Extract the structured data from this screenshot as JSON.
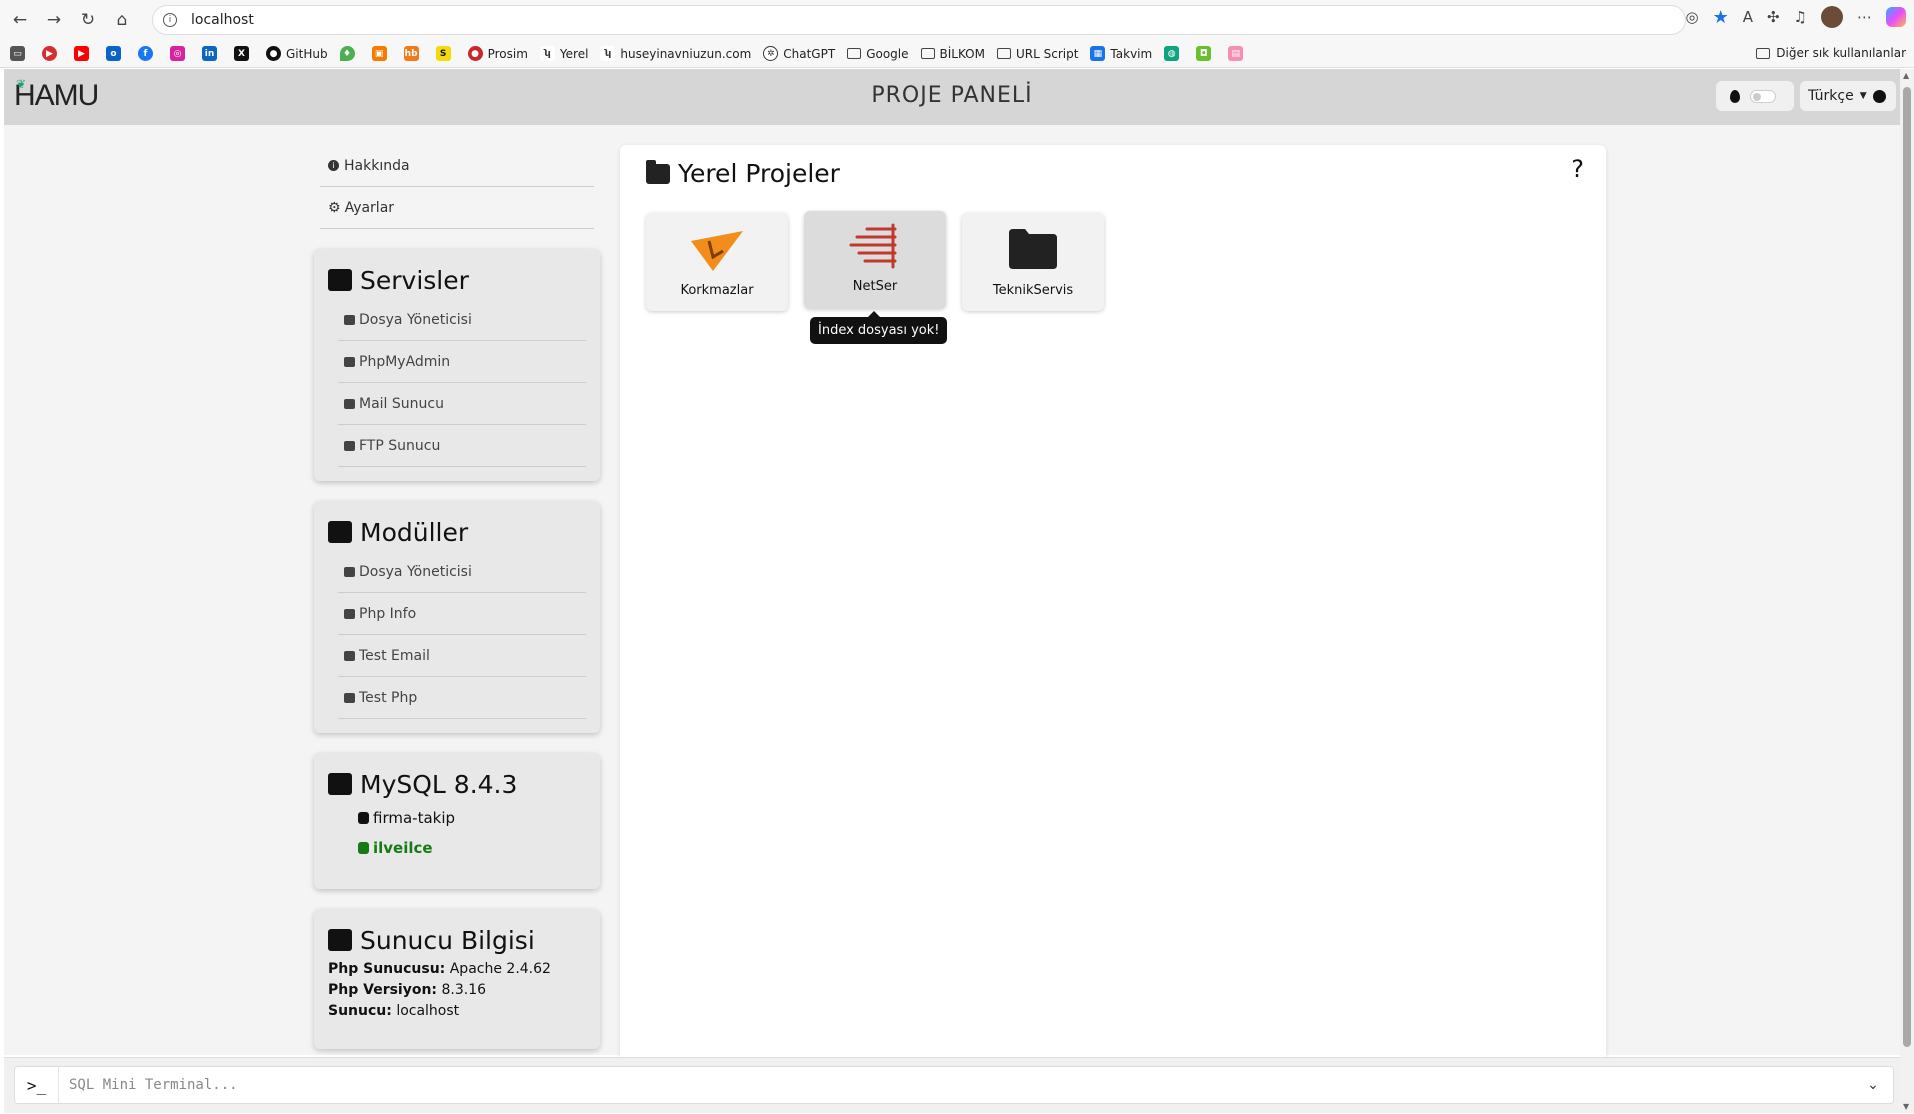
{
  "browser": {
    "url": "localhost",
    "bookmarks": [
      "GitHub",
      "Prosim",
      "Yerel",
      "huseyinavniuzun.com",
      "ChatGPT",
      "Google",
      "BİLKOM",
      "URL Script",
      "Takvim"
    ],
    "other_bookmarks": "Diğer sık kullanılanlar"
  },
  "header": {
    "logo": "HAMU",
    "title": "PROJE PANELİ",
    "language": "Türkçe"
  },
  "sidebar": {
    "links": [
      {
        "label": "Hakkında"
      },
      {
        "label": "Ayarlar"
      }
    ],
    "services": {
      "title": "Servisler",
      "items": [
        "Dosya Yöneticisi",
        "PhpMyAdmin",
        "Mail Sunucu",
        "FTP Sunucu"
      ]
    },
    "modules": {
      "title": "Modüller",
      "items": [
        "Dosya Yöneticisi",
        "Php Info",
        "Test Email",
        "Test Php"
      ]
    },
    "mysql": {
      "title": "MySQL 8.4.3",
      "databases": [
        "firma-takip",
        "ilveilce"
      ],
      "active_db": "ilveilce"
    },
    "server": {
      "title": "Sunucu Bilgisi",
      "rows": [
        {
          "key": "Php Sunucusu:",
          "value": "Apache 2.4.62"
        },
        {
          "key": "Php Versiyon:",
          "value": "8.3.16"
        },
        {
          "key": "Sunucu:",
          "value": "localhost"
        }
      ]
    }
  },
  "main": {
    "title": "Yerel Projeler",
    "help": "?",
    "projects": [
      {
        "name": "Korkmazlar",
        "icon": "korkmazlar-logo",
        "color": "#f28c1a"
      },
      {
        "name": "NetSer",
        "icon": "netser-logo",
        "color": "#c0392b"
      },
      {
        "name": "TeknikServis",
        "icon": "folder-icon",
        "color": "#222222"
      }
    ],
    "tooltip": "İndex dosyası yok!"
  },
  "terminal": {
    "prompt": ">_",
    "placeholder": "SQL Mini Terminal..."
  }
}
